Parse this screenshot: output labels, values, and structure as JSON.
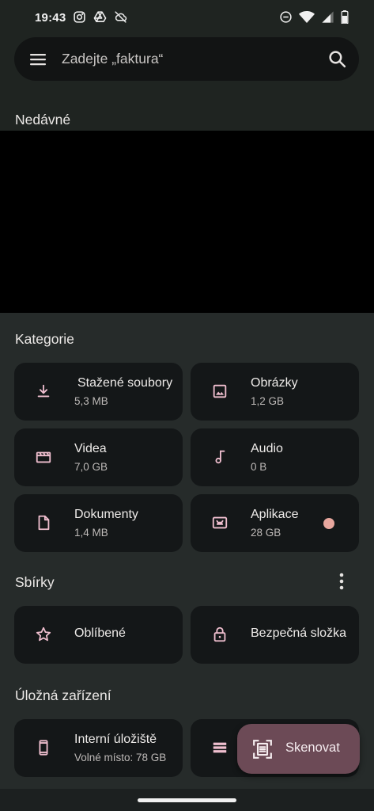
{
  "status_bar": {
    "time": "19:43",
    "left_icons": [
      "instagram-icon",
      "drive-icon",
      "cloud-off-icon"
    ],
    "right_icons": [
      "dnd-icon",
      "wifi-icon",
      "signal-icon",
      "battery-icon"
    ]
  },
  "search": {
    "placeholder": "Zadejte „faktura“"
  },
  "sections": {
    "recent": "Nedávné",
    "categories": "Kategorie",
    "collections": "Sbírky",
    "storage": "Úložná zařízení"
  },
  "categories": [
    {
      "title": "Stažené soubory",
      "sub": "5,3 MB",
      "icon": "download-icon"
    },
    {
      "title": "Obrázky",
      "sub": "1,2 GB",
      "icon": "image-icon"
    },
    {
      "title": "Videa",
      "sub": "7,0 GB",
      "icon": "video-icon"
    },
    {
      "title": "Audio",
      "sub": "0 B",
      "icon": "music-note-icon"
    },
    {
      "title": "Dokumenty",
      "sub": "1,4 MB",
      "icon": "document-icon"
    },
    {
      "title": "Aplikace",
      "sub": "28 GB",
      "icon": "android-icon",
      "badge_color": "#e8a79e"
    }
  ],
  "collections": [
    {
      "title": "Oblíbené",
      "icon": "star-icon"
    },
    {
      "title": "Bezpečná složka",
      "icon": "lock-icon"
    }
  ],
  "storage": [
    {
      "title": "Interní úložiště",
      "sub": "Volné místo: 78 GB",
      "icon": "phone-icon"
    },
    {
      "icon": "storage-icon"
    }
  ],
  "fab": {
    "label": "Skenovat",
    "icon": "document-scanner-icon"
  },
  "colors": {
    "background": "#1f2421",
    "card": "#141718",
    "accent_icon": "#f0bfcf",
    "fab": "#6c4a56"
  }
}
